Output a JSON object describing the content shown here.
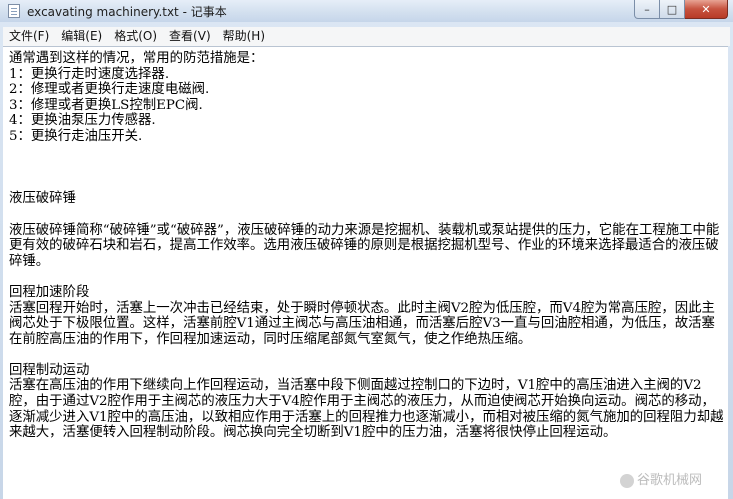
{
  "window": {
    "title": "excavating machinery.txt - 记事本",
    "minimize_label": "–",
    "maximize_label": "□",
    "close_label": "✕"
  },
  "menu": [
    "文件(F)",
    "编辑(E)",
    "格式(O)",
    "查看(V)",
    "帮助(H)"
  ],
  "document": {
    "lines": [
      "通常遇到这样的情况，常用的防范措施是：",
      "1：更换行走时速度选择器.",
      "2：修理或者更换行走速度电磁阀.",
      "3：修理或者更换LS控制EPC阀.",
      "4：更换油泵压力传感器.",
      "5：更换行走油压开关.",
      "",
      "",
      "",
      "液压破碎锤",
      "",
      "液压破碎锤简称“破碎锤”或“破碎器”，液压破碎锤的动力来源是挖掘机、装载机或泵站提供的压力，它能在工程施工中能更有效的破碎石块和岩石，提高工作效率。选用液压破碎锤的原则是根据挖掘机型号、作业的环境来选择最适合的液压破碎锤。",
      "",
      "回程加速阶段",
      "活塞回程开始时，活塞上一次冲击已经结束，处于瞬时停顿状态。此时主阀V2腔为低压腔，而V4腔为常高压腔，因此主阀芯处于下极限位置。这样，活塞前腔V1通过主阀芯与高压油相通，而活塞后腔V3一直与回油腔相通，为低压，故活塞在前腔高压油的作用下，作回程加速运动，同时压缩尾部氮气室氮气，使之作绝热压缩。",
      "",
      "回程制动运动",
      "活塞在高压油的作用下继续向上作回程运动，当活塞中段下侧面越过控制口的下边时，V1腔中的高压油进入主阀的V2腔，由于通过V2腔作用于主阀芯的液压力大于V4腔作用于主阀芯的液压力，从而迫使阀芯开始换向运动。阀芯的移动，逐渐减少进入V1腔中的高压油，以致相应作用于活塞上的回程推力也逐渐减小，而相对被压缩的氮气施加的回程阻力却越来越大，活塞便转入回程制动阶段。阀芯换向完全切断到V1腔中的压力油，活塞将很快停止回程运动。"
    ]
  },
  "watermark": "谷歌机械网"
}
